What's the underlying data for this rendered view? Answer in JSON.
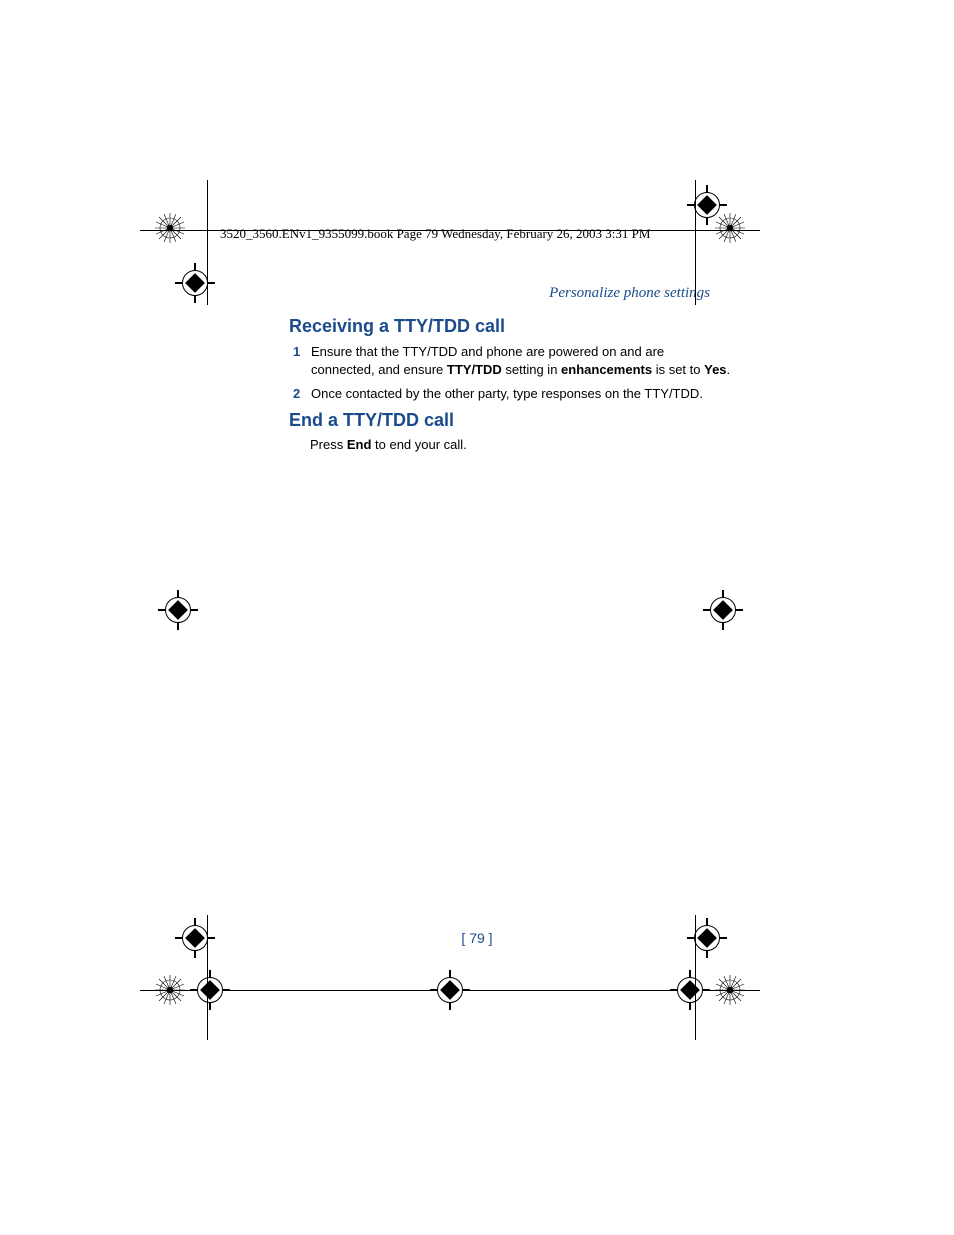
{
  "header": "3520_3560.ENv1_9355099.book  Page 79  Wednesday, February 26, 2003  3:31 PM",
  "sectionHeader": "Personalize phone settings",
  "heading1": "Receiving a TTY/TDD call",
  "step1_num": "1",
  "step1_a": "Ensure that the TTY/TDD and phone are powered on and are connected, and ensure ",
  "step1_b": "TTY/TDD",
  "step1_c": " setting in ",
  "step1_d": "enhancements",
  "step1_e": " is set to ",
  "step1_f": "Yes",
  "step1_g": ".",
  "step2_num": "2",
  "step2": "Once contacted by the other party, type responses on the TTY/TDD.",
  "heading2": "End a TTY/TDD call",
  "body2_a": "Press ",
  "body2_b": "End",
  "body2_c": " to end your call.",
  "pageNum": "[ 79 ]"
}
